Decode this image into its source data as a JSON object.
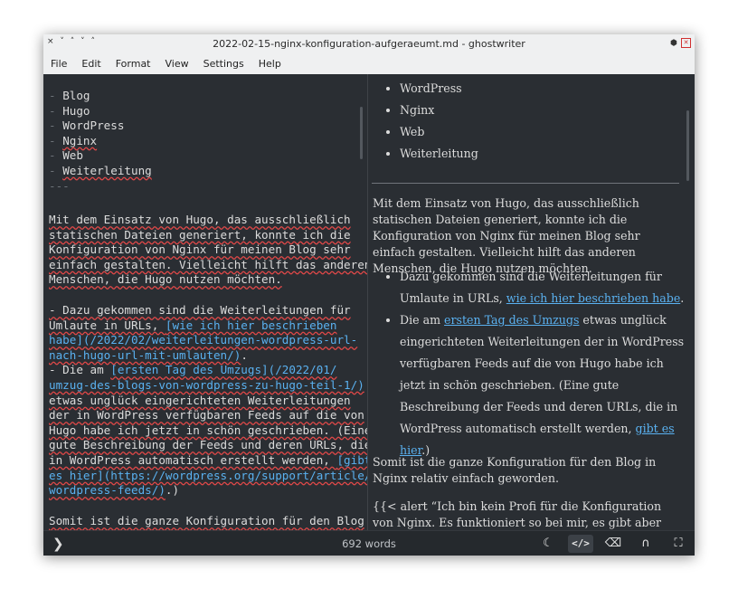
{
  "window": {
    "title": "2022-02-15-nginx-konfiguration-aufgeraeumt.md - ghostwriter",
    "controls_left": "× ˅ ˄ ˅ ˄"
  },
  "menu": [
    "File",
    "Edit",
    "Format",
    "View",
    "Settings",
    "Help"
  ],
  "editor": {
    "tag_marker": "-",
    "tags": [
      "Blog",
      "Hugo",
      "WordPress",
      "Nginx",
      "Web",
      "Weiterleitung"
    ],
    "frontmatter_end": "---",
    "p1_l1": "Mit dem Einsatz von Hugo, das ausschließlich",
    "p1_l2": "statischen Dateien generiert, konnte ich die",
    "p1_l3": "Konfiguration von Nginx für meinen Blog sehr",
    "p1_l4": "einfach gestalten. Vielleicht hilft das anderen",
    "p1_l5": "Menschen, die Hugo nutzen möchten.",
    "b1_l1": "- Dazu gekommen sind die Weiterleitungen für",
    "b1_l2a": "Umlaute in URLs, ",
    "b1_l2b": "[wie ich hier beschrieben",
    "b1_l3": "habe](/2022/02/weiterleitungen-wordpress-url-",
    "b1_l4a": "nach-hugo-url-mit-umlauten/)",
    "b1_l4b": ".",
    "b2_l1a": "- Die am ",
    "b2_l1b": "[ersten Tag des Umzugs](/2022/01/",
    "b2_l2": "umzug-des-blogs-von-wordpress-zu-hugo-teil-1/)",
    "b2_l3": "etwas unglück eingerichteten Weiterleitungen",
    "b2_l4": "der in WordPress verfügbaren Feeds auf die von",
    "b2_l5": "Hugo habe ich jetzt in schön geschrieben. (Eine",
    "b2_l6": "gute Beschreibung der Feeds und deren URLs, die",
    "b2_l7a": "in WordPress automatisch erstellt werden, ",
    "b2_l7b": "[gibt",
    "b2_l8": "es hier](https://wordpress.org/support/article/",
    "b2_l9a": "wordpress-feeds/)",
    "b2_l9b": ".)",
    "p2_l1": "Somit ist die ganze Konfiguration für den Blog"
  },
  "preview": {
    "list": [
      "WordPress",
      "Nginx",
      "Web",
      "Weiterleitung"
    ],
    "para1": "Mit dem Einsatz von Hugo, das ausschließlich statischen Dateien generiert, konnte ich die Konfiguration von Nginx für meinen Blog sehr einfach gestalten. Vielleicht hilft das anderen Menschen, die Hugo nutzen möchten.",
    "b1_text": "Dazu gekommen sind die Weiterleitungen für Umlaute in URLs, ",
    "b1_link": "wie ich hier beschrieben habe",
    "b1_end": ".",
    "b2_pre": "Die am ",
    "b2_link": "ersten Tag des Umzugs",
    "b2_mid": " etwas unglück eingerichteten Weiterleitungen der in WordPress verfügbaren Feeds auf die von Hugo habe ich jetzt in schön geschrieben. (Eine gute Beschreibung der Feeds und deren URLs, die in WordPress automatisch erstellt werden, ",
    "b2_link2": "gibt es hier",
    "b2_end": ".)",
    "para2": "Somit ist die ganze Konfiguration für den Blog in Nginx relativ einfach geworden.",
    "para3": "{{< alert “Ich bin kein Profi für die Konfiguration von Nginx. Es funktioniert so bei mir, es gibt aber keine"
  },
  "status": {
    "word_count": "692 words",
    "buttons": [
      "moon-icon",
      "html-preview-icon",
      "backspace-icon",
      "headphones-icon",
      "fullscreen-icon"
    ]
  },
  "colors": {
    "bg": "#2a2e33",
    "text": "#dcdcdc",
    "link": "#5ab1f0",
    "spell": "#e04848"
  }
}
